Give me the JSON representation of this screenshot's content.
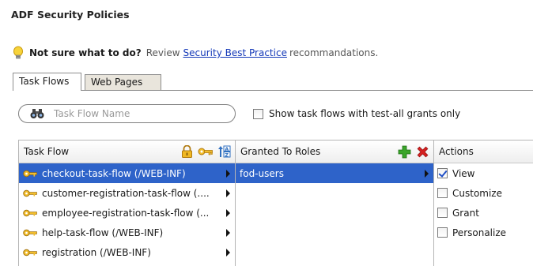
{
  "page": {
    "title": "ADF Security Policies"
  },
  "hint": {
    "lead": "Not sure what to do?",
    "before_link": "Review",
    "link": "Security Best Practice",
    "after_link": "recommandations."
  },
  "tabs": [
    {
      "label": "Task Flows",
      "active": true
    },
    {
      "label": "Web Pages",
      "active": false
    }
  ],
  "search": {
    "placeholder": "Task Flow Name",
    "value": ""
  },
  "filter": {
    "label": "Show task flows with test-all grants only",
    "checked": false
  },
  "columns": {
    "task_flow": "Task Flow",
    "granted_to_roles": "Granted To Roles",
    "actions": "Actions"
  },
  "task_flows": [
    {
      "label": "checkout-task-flow (/WEB-INF)",
      "selected": true
    },
    {
      "label": "customer-registration-task-flow (.... ",
      "selected": false
    },
    {
      "label": "employee-registration-task-flow (... ",
      "selected": false
    },
    {
      "label": "help-task-flow (/WEB-INF)",
      "selected": false
    },
    {
      "label": "registration (/WEB-INF)",
      "selected": false
    }
  ],
  "roles": [
    {
      "label": "fod-users",
      "selected": true
    }
  ],
  "actions": [
    {
      "label": "View",
      "checked": true
    },
    {
      "label": "Customize",
      "checked": false
    },
    {
      "label": "Grant",
      "checked": false
    },
    {
      "label": "Personalize",
      "checked": false
    }
  ],
  "colors": {
    "selection": "#2e63c9",
    "link": "#1338b8",
    "add_green": "#3aa52a",
    "delete_red": "#d42020",
    "key_gold": "#e0a020"
  }
}
